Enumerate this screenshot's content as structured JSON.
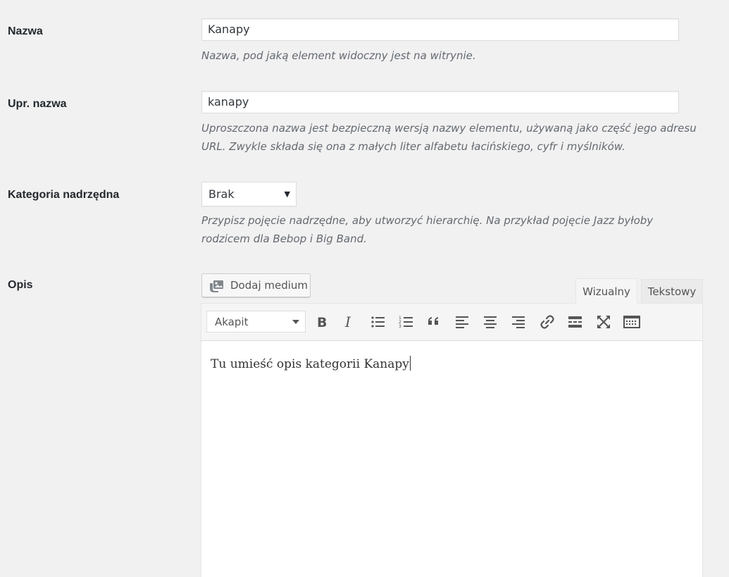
{
  "fields": {
    "name": {
      "label": "Nazwa",
      "value": "Kanapy",
      "description": "Nazwa, pod jaką element widoczny jest na witrynie."
    },
    "slug": {
      "label": "Upr. nazwa",
      "value": "kanapy",
      "description_line1": "Uproszczona nazwa jest bezpieczną wersją nazwy elementu, używaną jako część jego adresu",
      "description_line2": "URL. Zwykle składa się ona z małych liter alfabetu łacińskiego, cyfr i myślników."
    },
    "parent": {
      "label": "Kategoria nadrzędna",
      "selected": "Brak",
      "description_line1": "Przypisz pojęcie nadrzędne, aby utworzyć hierarchię. Na przykład pojęcie Jazz byłoby",
      "description_line2": "rodzicem dla Bebop i Big Band."
    },
    "description": {
      "label": "Opis"
    }
  },
  "editor": {
    "add_media_label": "Dodaj medium",
    "tab_visual": "Wizualny",
    "tab_text": "Tekstowy",
    "format_selected": "Akapit",
    "content": "Tu umieść opis kategorii Kanapy",
    "toolbar_icons": [
      "bold-icon",
      "italic-icon",
      "bullet-list-icon",
      "numbered-list-icon",
      "blockquote-icon",
      "align-left-icon",
      "align-center-icon",
      "align-right-icon",
      "link-icon",
      "read-more-icon",
      "fullscreen-icon",
      "toolbar-toggle-icon"
    ]
  }
}
